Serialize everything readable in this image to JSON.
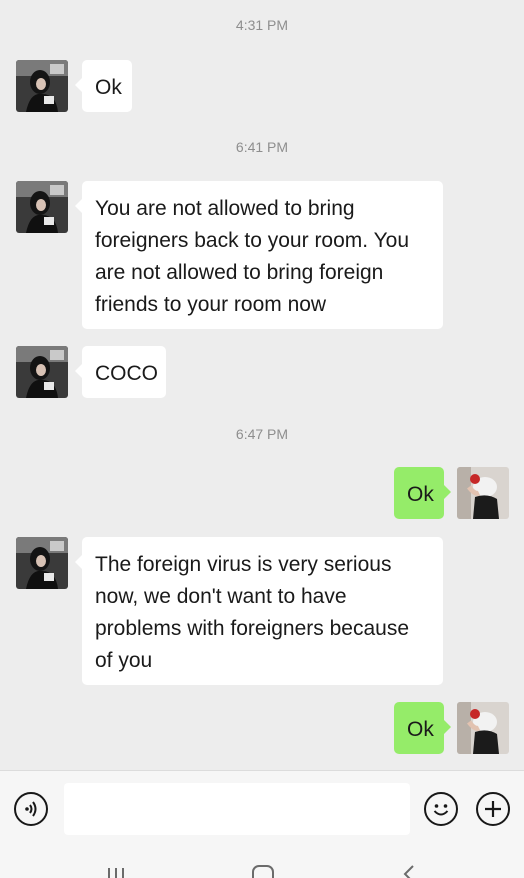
{
  "chat": {
    "timestamps": [
      "4:31 PM",
      "6:41 PM",
      "6:47 PM"
    ],
    "messages": [
      {
        "from": "contact",
        "text": "Ok"
      },
      {
        "from": "contact",
        "text": "You are not allowed to bring foreigners back to your room. You are not allowed to bring foreign friends to your room now"
      },
      {
        "from": "contact",
        "text": "COCO"
      },
      {
        "from": "me",
        "text": "Ok"
      },
      {
        "from": "contact",
        "text": "The foreign virus is very serious now, we don't want to have problems with foreigners because of you"
      },
      {
        "from": "me",
        "text": "Ok"
      }
    ]
  },
  "input_bar": {
    "voice_icon": "voice-icon",
    "emoji_icon": "emoji-icon",
    "plus_icon": "plus-icon",
    "text_value": ""
  },
  "nav_bar": {
    "icons": [
      "recent-apps-icon",
      "home-icon",
      "back-icon"
    ]
  },
  "colors": {
    "background": "#ededed",
    "incoming_bubble": "#ffffff",
    "outgoing_bubble": "#95ec69",
    "timestamp_text": "#8e8e8e"
  }
}
